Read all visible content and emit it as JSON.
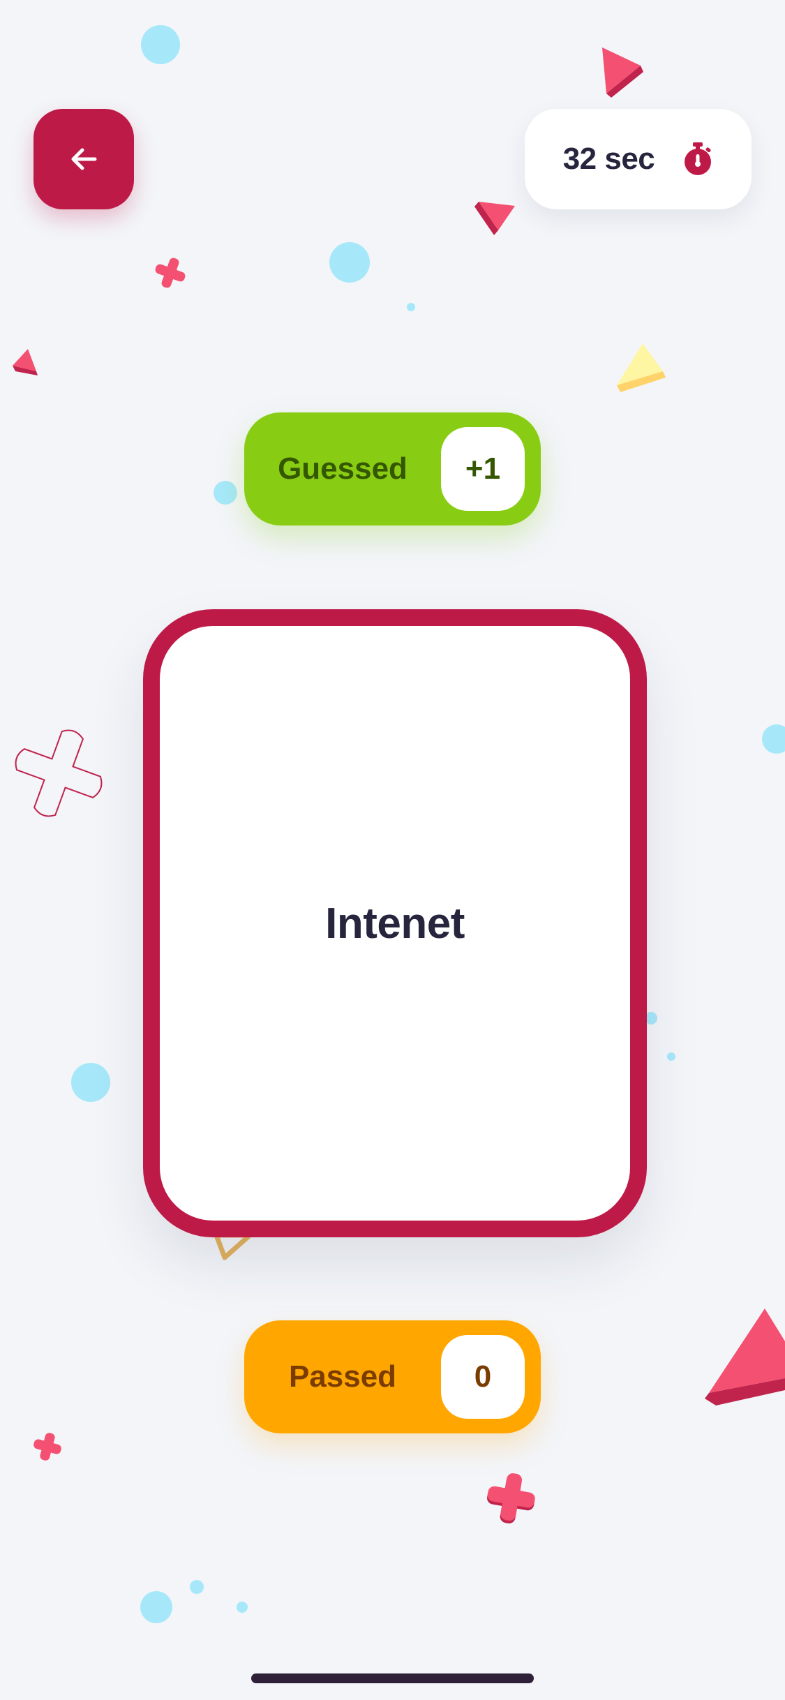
{
  "header": {
    "back_icon": "arrow-left-icon",
    "timer_text": "32 sec",
    "timer_icon": "stopwatch-icon"
  },
  "guessed": {
    "label": "Guessed",
    "count": "+1"
  },
  "card": {
    "word": "Intenet"
  },
  "passed": {
    "label": "Passed",
    "count": "0"
  },
  "colors": {
    "background": "#f3f5f9",
    "primary": "#be1a47",
    "guessed": "#88cd14",
    "passed": "#ffa601",
    "text_dark": "#27253e"
  }
}
